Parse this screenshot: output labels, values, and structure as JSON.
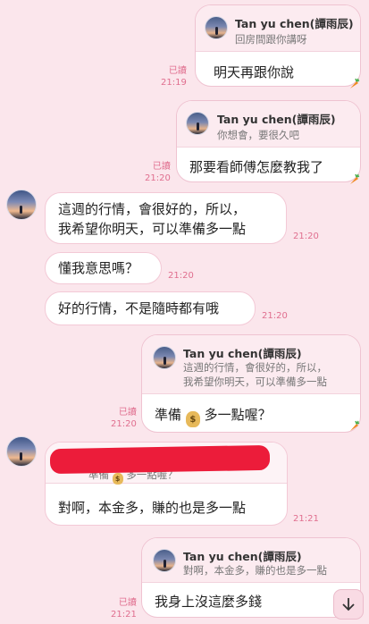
{
  "reply_author": "Tan yu chen(譚雨辰)",
  "read_label": "已讀",
  "messages": [
    {
      "quote": "回房間跟你講呀",
      "text": "明天再跟你說",
      "time": "21:19"
    },
    {
      "quote": "你想會，要很久吧",
      "text": "那要看師傅怎麼教我了",
      "time": "21:20"
    },
    {
      "line1": "這週的行情，會很好的，所以，",
      "line2": "我希望你明天，可以準備多一點",
      "time": "21:20"
    },
    {
      "text": "懂我意思嗎？",
      "time": "21:20"
    },
    {
      "text": "好的行情，不是隨時都有哦",
      "time": "21:20"
    },
    {
      "quote1": "這週的行情，會很好的，所以，",
      "quote2": "我希望你明天，可以準備多一點",
      "text_a": "準備",
      "text_b": "多一點喔？",
      "time": "21:20"
    },
    {
      "quote_a": "準備",
      "quote_b": "多一點喔？",
      "text": "對啊，本金多，賺的也是多一點",
      "time": "21:21"
    },
    {
      "quote": "對啊，本金多，賺的也是多一點",
      "text": "我身上沒這麼多錢",
      "time": "21:21"
    }
  ],
  "icons": {
    "money_bag": "money-bag-emoji",
    "carrot": "carrot-sticker",
    "scroll": "arrow-down-icon"
  },
  "colors": {
    "background": "#fbe6ec",
    "accent": "#e06f8f",
    "redaction": "#ec1c3a"
  }
}
